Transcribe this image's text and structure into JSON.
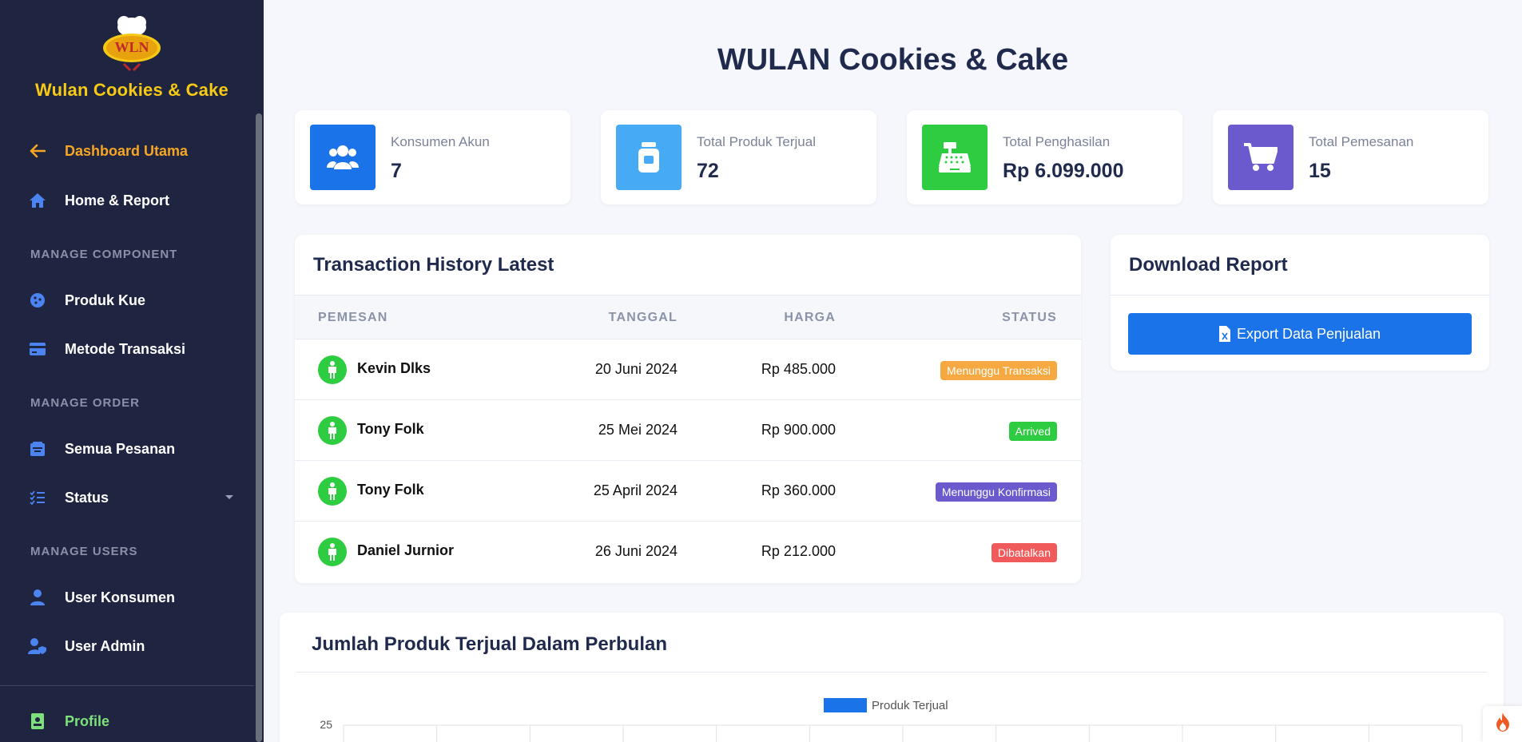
{
  "brand": {
    "name": "Wulan Cookies & Cake",
    "logo_text": "WLN"
  },
  "sidebar": {
    "dashboard": "Dashboard Utama",
    "home": "Home & Report",
    "section_component": "MANAGE COMPONENT",
    "produk": "Produk Kue",
    "metode": "Metode Transaksi",
    "section_order": "MANAGE ORDER",
    "pesanan": "Semua Pesanan",
    "status": "Status",
    "section_users": "MANAGE USERS",
    "konsumen": "User Konsumen",
    "admin": "User Admin",
    "profile": "Profile"
  },
  "page_title": "WULAN Cookies & Cake",
  "stats": [
    {
      "label": "Konsumen Akun",
      "value": "7",
      "color": "#1a73e8",
      "icon": "users-icon"
    },
    {
      "label": "Total Produk Terjual",
      "value": "72",
      "color": "#47aaf5",
      "icon": "jar-icon"
    },
    {
      "label": "Total Penghasilan",
      "value": "Rp 6.099.000",
      "color": "#2ecc40",
      "icon": "cash-register-icon"
    },
    {
      "label": "Total Pemesanan",
      "value": "15",
      "color": "#6a5acd",
      "icon": "cart-icon"
    }
  ],
  "transactions": {
    "title": "Transaction History Latest",
    "headers": {
      "customer": "PEMESAN",
      "date": "TANGGAL",
      "price": "HARGA",
      "status": "STATUS"
    },
    "rows": [
      {
        "customer": "Kevin Dlks",
        "date": "20 Juni 2024",
        "price": "Rp 485.000",
        "status": "Menunggu Transaksi",
        "status_color": "#f6a940"
      },
      {
        "customer": "Tony Folk",
        "date": "25 Mei 2024",
        "price": "Rp 900.000",
        "status": "Arrived",
        "status_color": "#2ecc40"
      },
      {
        "customer": "Tony Folk",
        "date": "25 April 2024",
        "price": "Rp 360.000",
        "status": "Menunggu Konfirmasi",
        "status_color": "#6a5acd"
      },
      {
        "customer": "Daniel Jurnior",
        "date": "26 Juni 2024",
        "price": "Rp 212.000",
        "status": "Dibatalkan",
        "status_color": "#f05a5a"
      }
    ]
  },
  "download": {
    "title": "Download Report",
    "button": "Export Data Penjualan"
  },
  "chart": {
    "title": "Jumlah Produk Terjual Dalam Perbulan"
  },
  "chart_data": {
    "type": "bar",
    "title": "Jumlah Produk Terjual Dalam Perbulan",
    "series": [
      {
        "name": "Produk Terjual",
        "color": "#1a73e8"
      }
    ],
    "y_tick_labels": [
      "25"
    ],
    "grid": true,
    "legend": "top-center"
  }
}
